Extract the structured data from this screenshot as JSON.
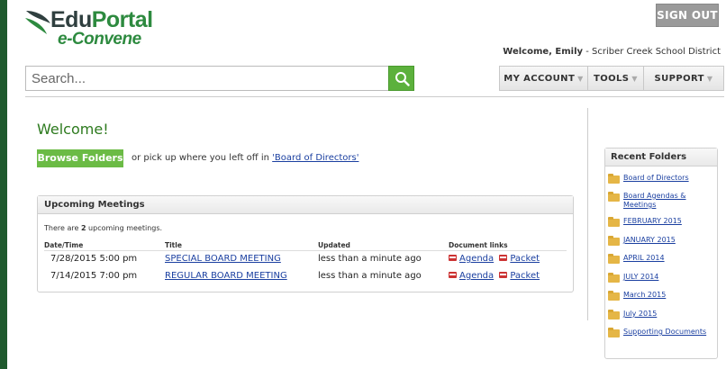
{
  "header": {
    "logo_line1_a": "Edu",
    "logo_line1_b": "Portal",
    "logo_line2": "e-Convene",
    "sign_out_label": "SIGN OUT",
    "welcome_prefix": "Welcome, Emily",
    "welcome_suffix": " - Scriber Creek School District"
  },
  "search": {
    "placeholder": "Search..."
  },
  "nav": {
    "items": [
      {
        "label": "MY ACCOUNT"
      },
      {
        "label": "TOOLS"
      },
      {
        "label": "SUPPORT"
      }
    ]
  },
  "main": {
    "title": "Welcome!",
    "browse_label": "Browse Folders",
    "pickup_text": "or pick up where you left off in",
    "pickup_link": "'Board of Directors'"
  },
  "meetings": {
    "title": "Upcoming Meetings",
    "count_prefix": "There are ",
    "count": "2",
    "count_suffix": " upcoming meetings.",
    "columns": [
      "Date/Time",
      "Title",
      "Updated",
      "Document links"
    ],
    "rows": [
      {
        "datetime": "7/28/2015 5:00 pm",
        "title": "SPECIAL BOARD MEETING",
        "updated": "less than a minute ago",
        "agenda": "Agenda",
        "packet": "Packet"
      },
      {
        "datetime": "7/14/2015 7:00 pm",
        "title": "REGULAR BOARD MEETING",
        "updated": "less than a minute ago",
        "agenda": "Agenda",
        "packet": "Packet"
      }
    ]
  },
  "recent": {
    "title": "Recent Folders",
    "folders": [
      "Board of Directors",
      "Board Agendas & Meetings",
      "FEBRUARY 2015",
      "JANUARY 2015",
      "APRIL 2014",
      "JULY 2014",
      "March 2015",
      "July 2015",
      "Supporting Documents"
    ]
  },
  "colors": {
    "brand_green": "#2d8a3f",
    "button_green": "#6bbb45",
    "link_blue": "#1a3fa0",
    "frame_border": "#1f5a2e"
  }
}
